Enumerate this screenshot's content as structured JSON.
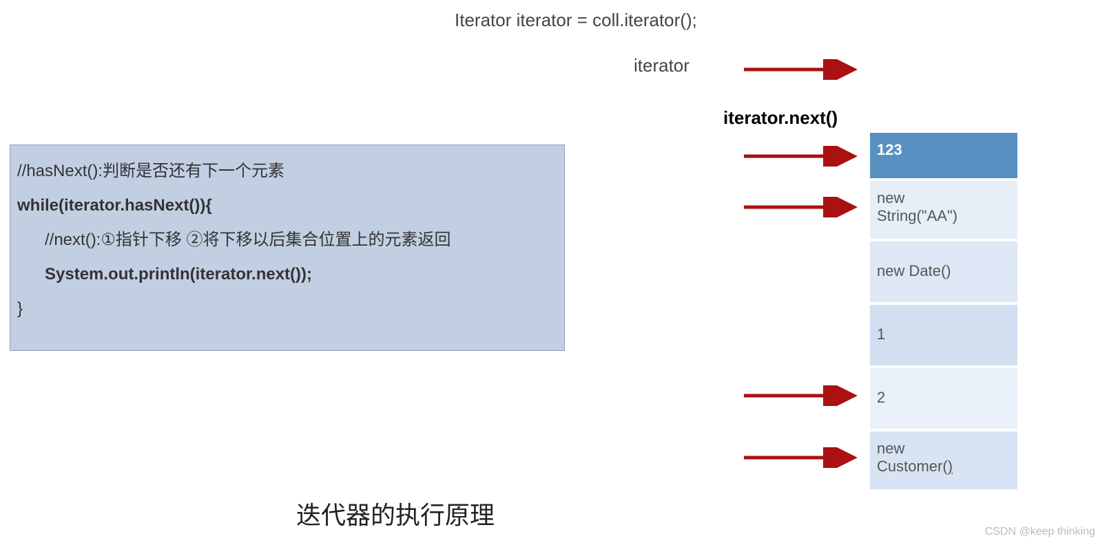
{
  "top": {
    "codeLine": "Iterator iterator = coll.iterator();",
    "iteratorLabel": "iterator",
    "nextLabel": "iterator.next()"
  },
  "codeBox": {
    "line1": "//hasNext():判断是否还有下一个元素",
    "line2": "while(iterator.hasNext()){",
    "line3": "//next():①指针下移 ②将下移以后集合位置上的元素返回",
    "line4": "System.out.println(iterator.next());",
    "line5": "}"
  },
  "cells": {
    "c1": "123",
    "c2a": "new",
    "c2b": "String(\"AA\")",
    "c3": "new Date()",
    "c4": "1",
    "c5": "2",
    "c6a": "new",
    "c6b": "Customer()"
  },
  "title": "迭代器的执行原理",
  "watermark": "CSDN @keep   thinking"
}
